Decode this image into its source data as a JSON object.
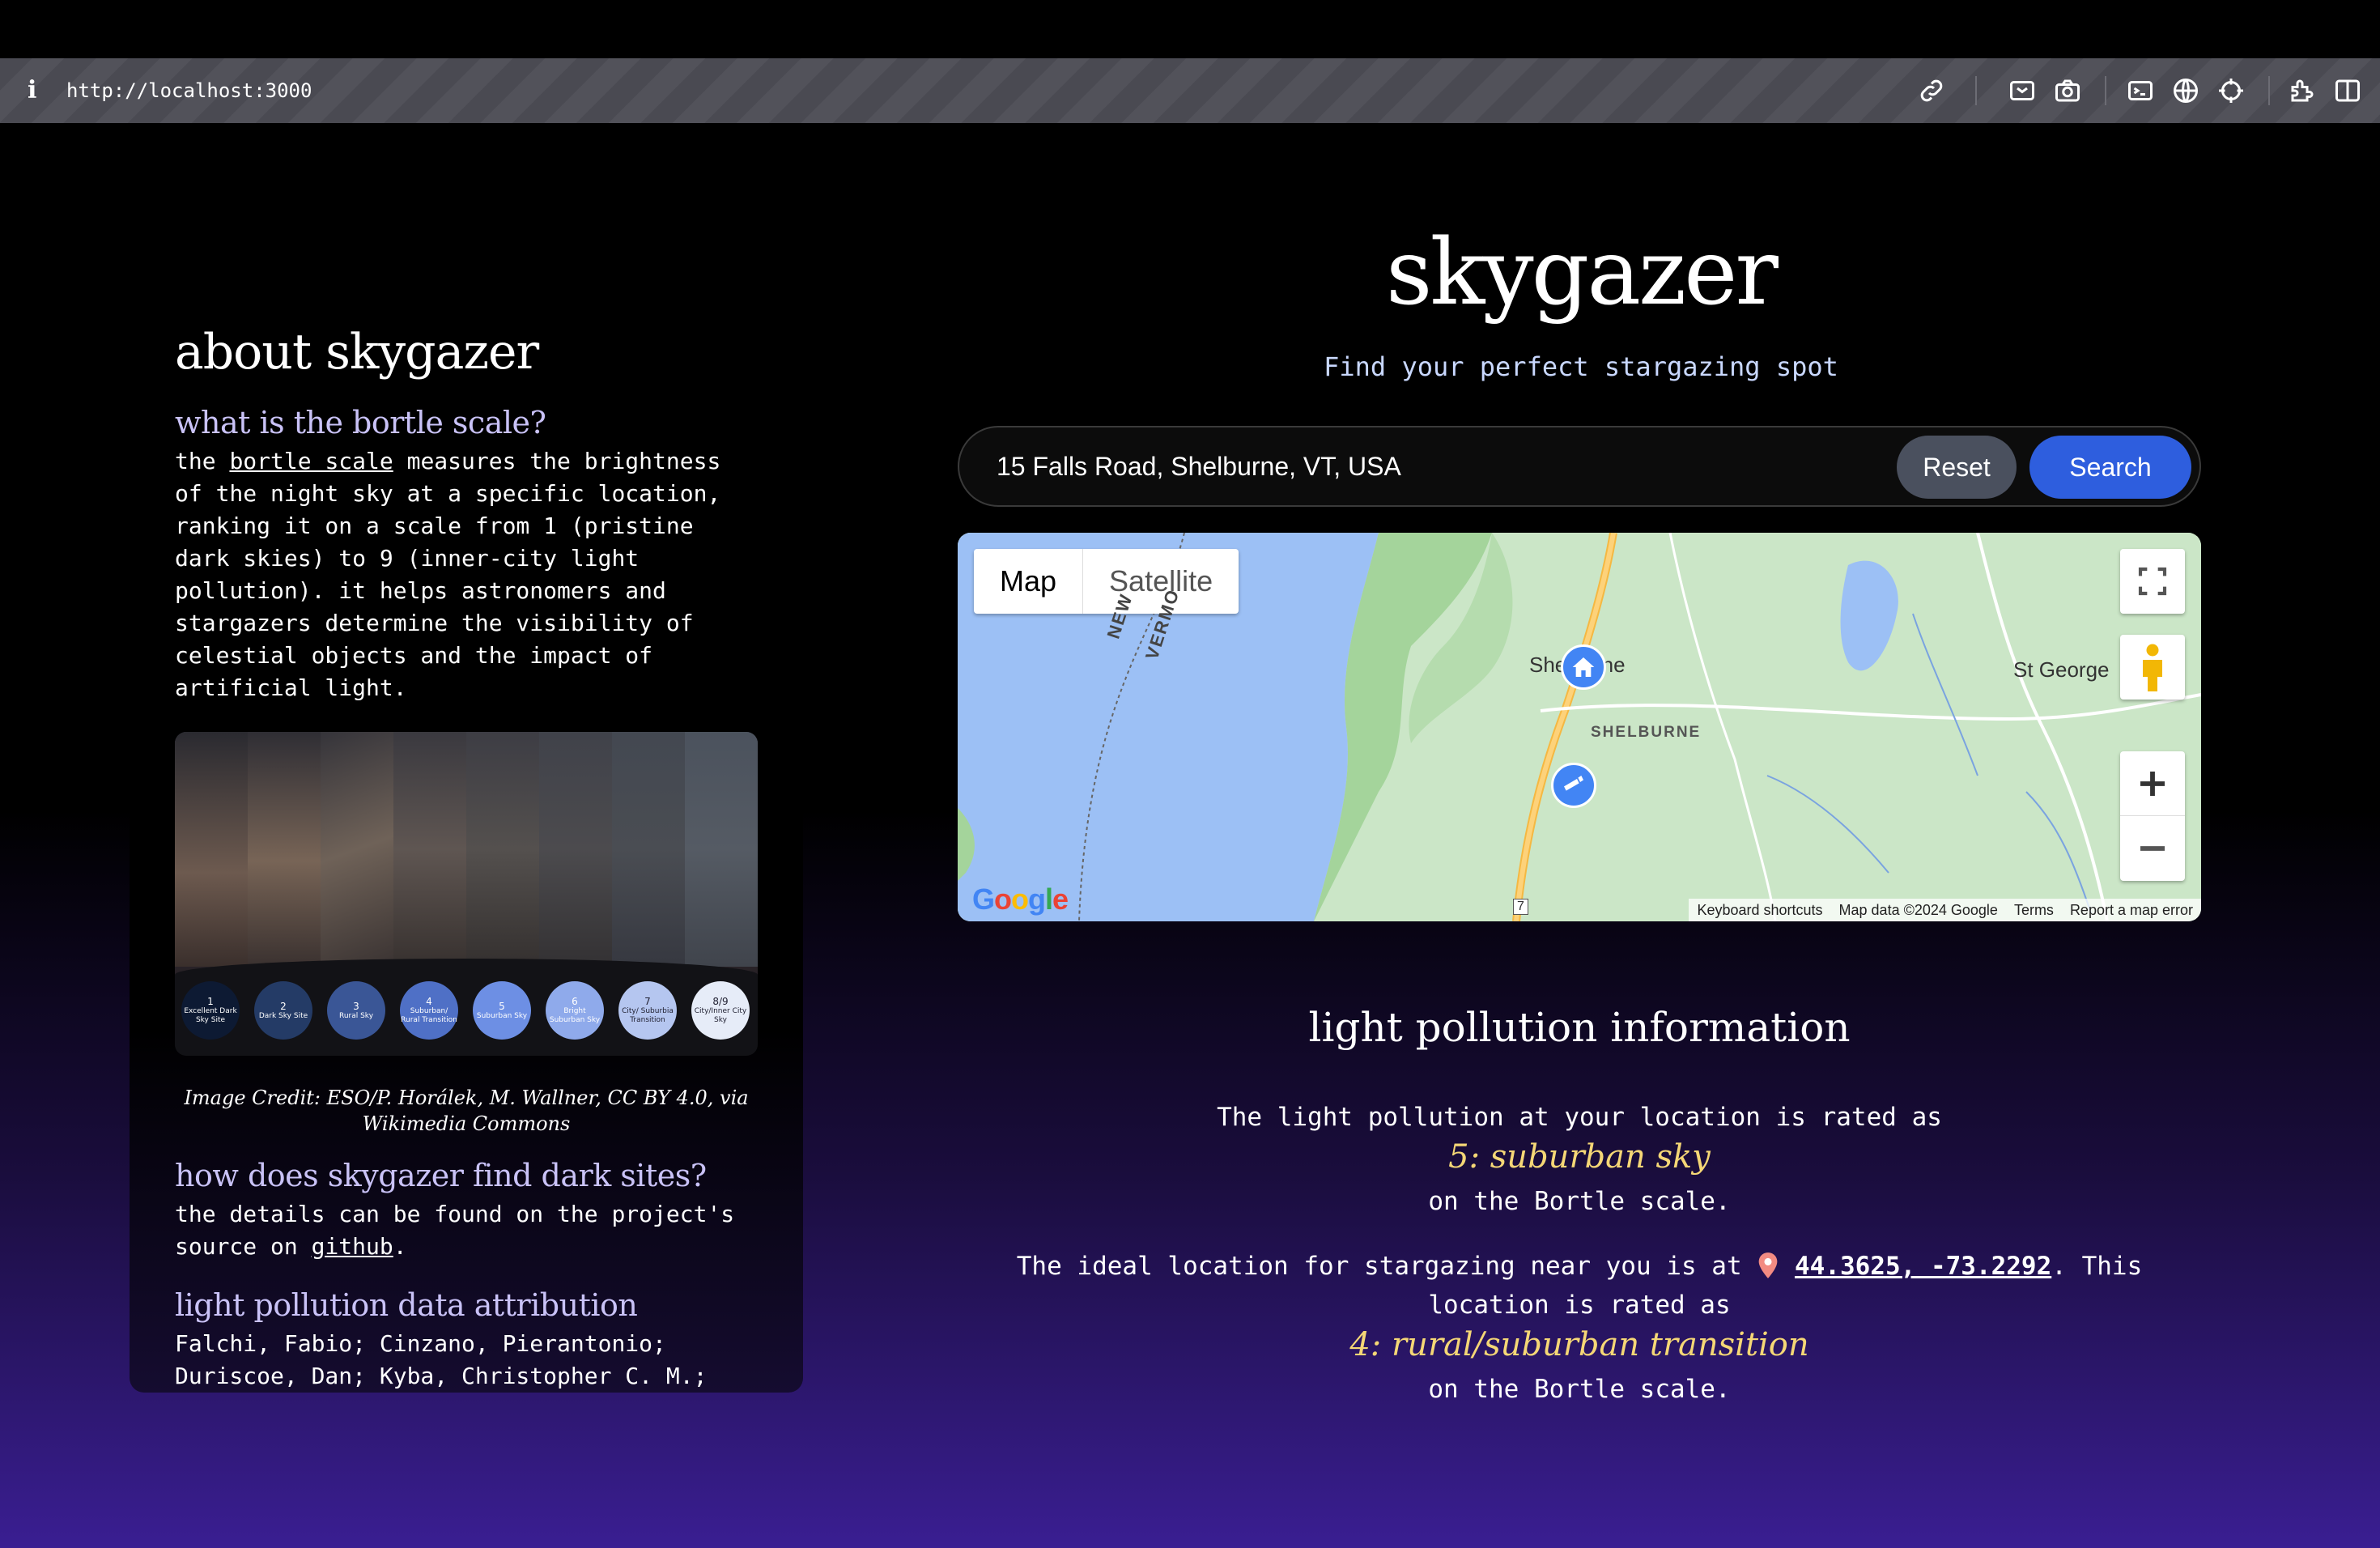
{
  "browser": {
    "url": "http://localhost:3000",
    "info_icon": "info-icon",
    "toolbar_icons": [
      "link-icon",
      "screenshot-icon",
      "camera-icon",
      "terminal-icon",
      "globe-icon",
      "crosshair-icon",
      "extensions-icon",
      "split-view-icon"
    ]
  },
  "sidebar": {
    "heading": "about skygazer",
    "sections": [
      {
        "heading": "what is the bortle scale?",
        "text_before_link": "the ",
        "link": "bortle scale",
        "text_after_link": " measures the brightness of the night sky at a specific location, ranking it on a scale from 1 (pristine dark skies) to 9 (inner-city light pollution). it helps astronomers and stargazers determine the visibility of celestial objects and the impact of artificial light."
      },
      {
        "heading": "how does skygazer find dark sites?",
        "text_before_link": "the details can be found on the project's source on ",
        "link": "github",
        "text_after_link": "."
      },
      {
        "heading": "light pollution data attribution",
        "text": "Falchi, Fabio; Cinzano, Pierantonio; Duriscoe, Dan; Kyba, Christopher C. M.;"
      }
    ],
    "image_credit": "Image Credit: ESO/P. Horálek, M. Wallner, CC BY 4.0, via Wikimedia Commons",
    "bortle_levels": [
      {
        "num": "1",
        "label": "Excellent Dark Sky Site",
        "color": "#0d1a33"
      },
      {
        "num": "2",
        "label": "Dark Sky Site",
        "color": "#243b66"
      },
      {
        "num": "3",
        "label": "Rural Sky",
        "color": "#3a5696"
      },
      {
        "num": "4",
        "label": "Suburban/ Rural Transition",
        "color": "#4f70c6"
      },
      {
        "num": "5",
        "label": "Suburban Sky",
        "color": "#6d8fe4"
      },
      {
        "num": "6",
        "label": "Bright Suburban Sky",
        "color": "#8faaeb"
      },
      {
        "num": "7",
        "label": "City/ Suburbia Transition",
        "color": "#b5c6f0"
      },
      {
        "num": "8/9",
        "label": "City/Inner City Sky",
        "color": "#e6ecf8"
      }
    ]
  },
  "header": {
    "title": "skygazer",
    "subtitle": "Find your perfect stargazing spot"
  },
  "search": {
    "value": "15 Falls Road, Shelburne, VT, USA",
    "reset_label": "Reset",
    "search_label": "Search"
  },
  "map": {
    "map_label": "Map",
    "satellite_label": "Satellite",
    "places": {
      "shelburne_town": "Shelburne",
      "shelburne_area": "SHELBURNE",
      "st_george": "St George",
      "new_york": "NEW",
      "vermont": "VERMO",
      "route": "7"
    },
    "google_logo": "Google",
    "attribution": [
      "Keyboard shortcuts",
      "Map data ©2024 Google",
      "Terms",
      "Report a map error"
    ],
    "home_pin_icon": "home-icon",
    "telescope_pin_icon": "telescope-icon"
  },
  "light_pollution": {
    "title": "light pollution information",
    "current_prefix": "The light pollution at your location is rated as",
    "current_rating": "5: suburban sky",
    "scale_suffix": "on the Bortle scale.",
    "ideal_prefix": "The ideal location for stargazing near you is at",
    "ideal_coords": "44.3625, -73.2292",
    "ideal_mid": ". This",
    "ideal_line2": "location is rated as",
    "ideal_rating": "4: rural/suburban transition",
    "ideal_suffix": "on the Bortle scale."
  }
}
